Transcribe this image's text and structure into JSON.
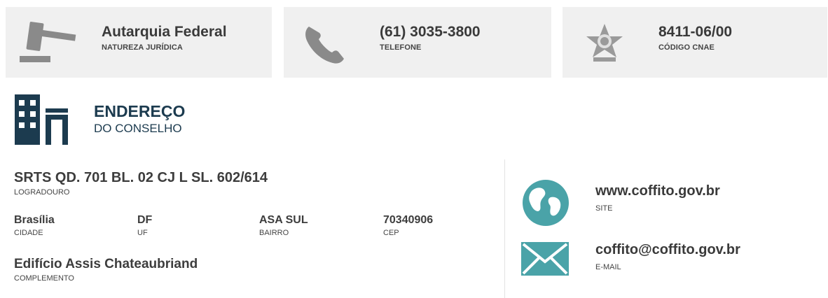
{
  "cards": [
    {
      "value": "Autarquia Federal",
      "label": "NATUREZA JURÍDICA",
      "icon": "gavel-icon"
    },
    {
      "value": "(61) 3035-3800",
      "label": "TELEFONE",
      "icon": "phone-icon"
    },
    {
      "value": "8411-06/00",
      "label": "CÓDIGO CNAE",
      "icon": "brazil-coat-of-arms-icon"
    }
  ],
  "section": {
    "title": "ENDEREÇO",
    "subtitle": "DO CONSELHO",
    "icon": "building-icon"
  },
  "address": {
    "logradouro": {
      "value": "SRTS QD. 701 BL. 02 CJ L SL. 602/614",
      "label": "LOGRADOURO"
    },
    "cidade": {
      "value": "Brasília",
      "label": "CIDADE"
    },
    "uf": {
      "value": "DF",
      "label": "UF"
    },
    "bairro": {
      "value": "ASA SUL",
      "label": "BAIRRO"
    },
    "cep": {
      "value": "70340906",
      "label": "CEP"
    },
    "complemento": {
      "value": "Edifício Assis Chateaubriand",
      "label": "COMPLEMENTO"
    }
  },
  "contacts": {
    "site": {
      "value": "www.coffito.gov.br",
      "label": "SITE",
      "icon": "globe-icon"
    },
    "email": {
      "value": "coffito@coffito.gov.br",
      "label": "E-MAIL",
      "icon": "envelope-icon"
    }
  },
  "colors": {
    "card_bg": "#f0f0f0",
    "icon_gray": "#8a8a8a",
    "navy": "#1c3b4f",
    "teal": "#4aa3a8"
  }
}
